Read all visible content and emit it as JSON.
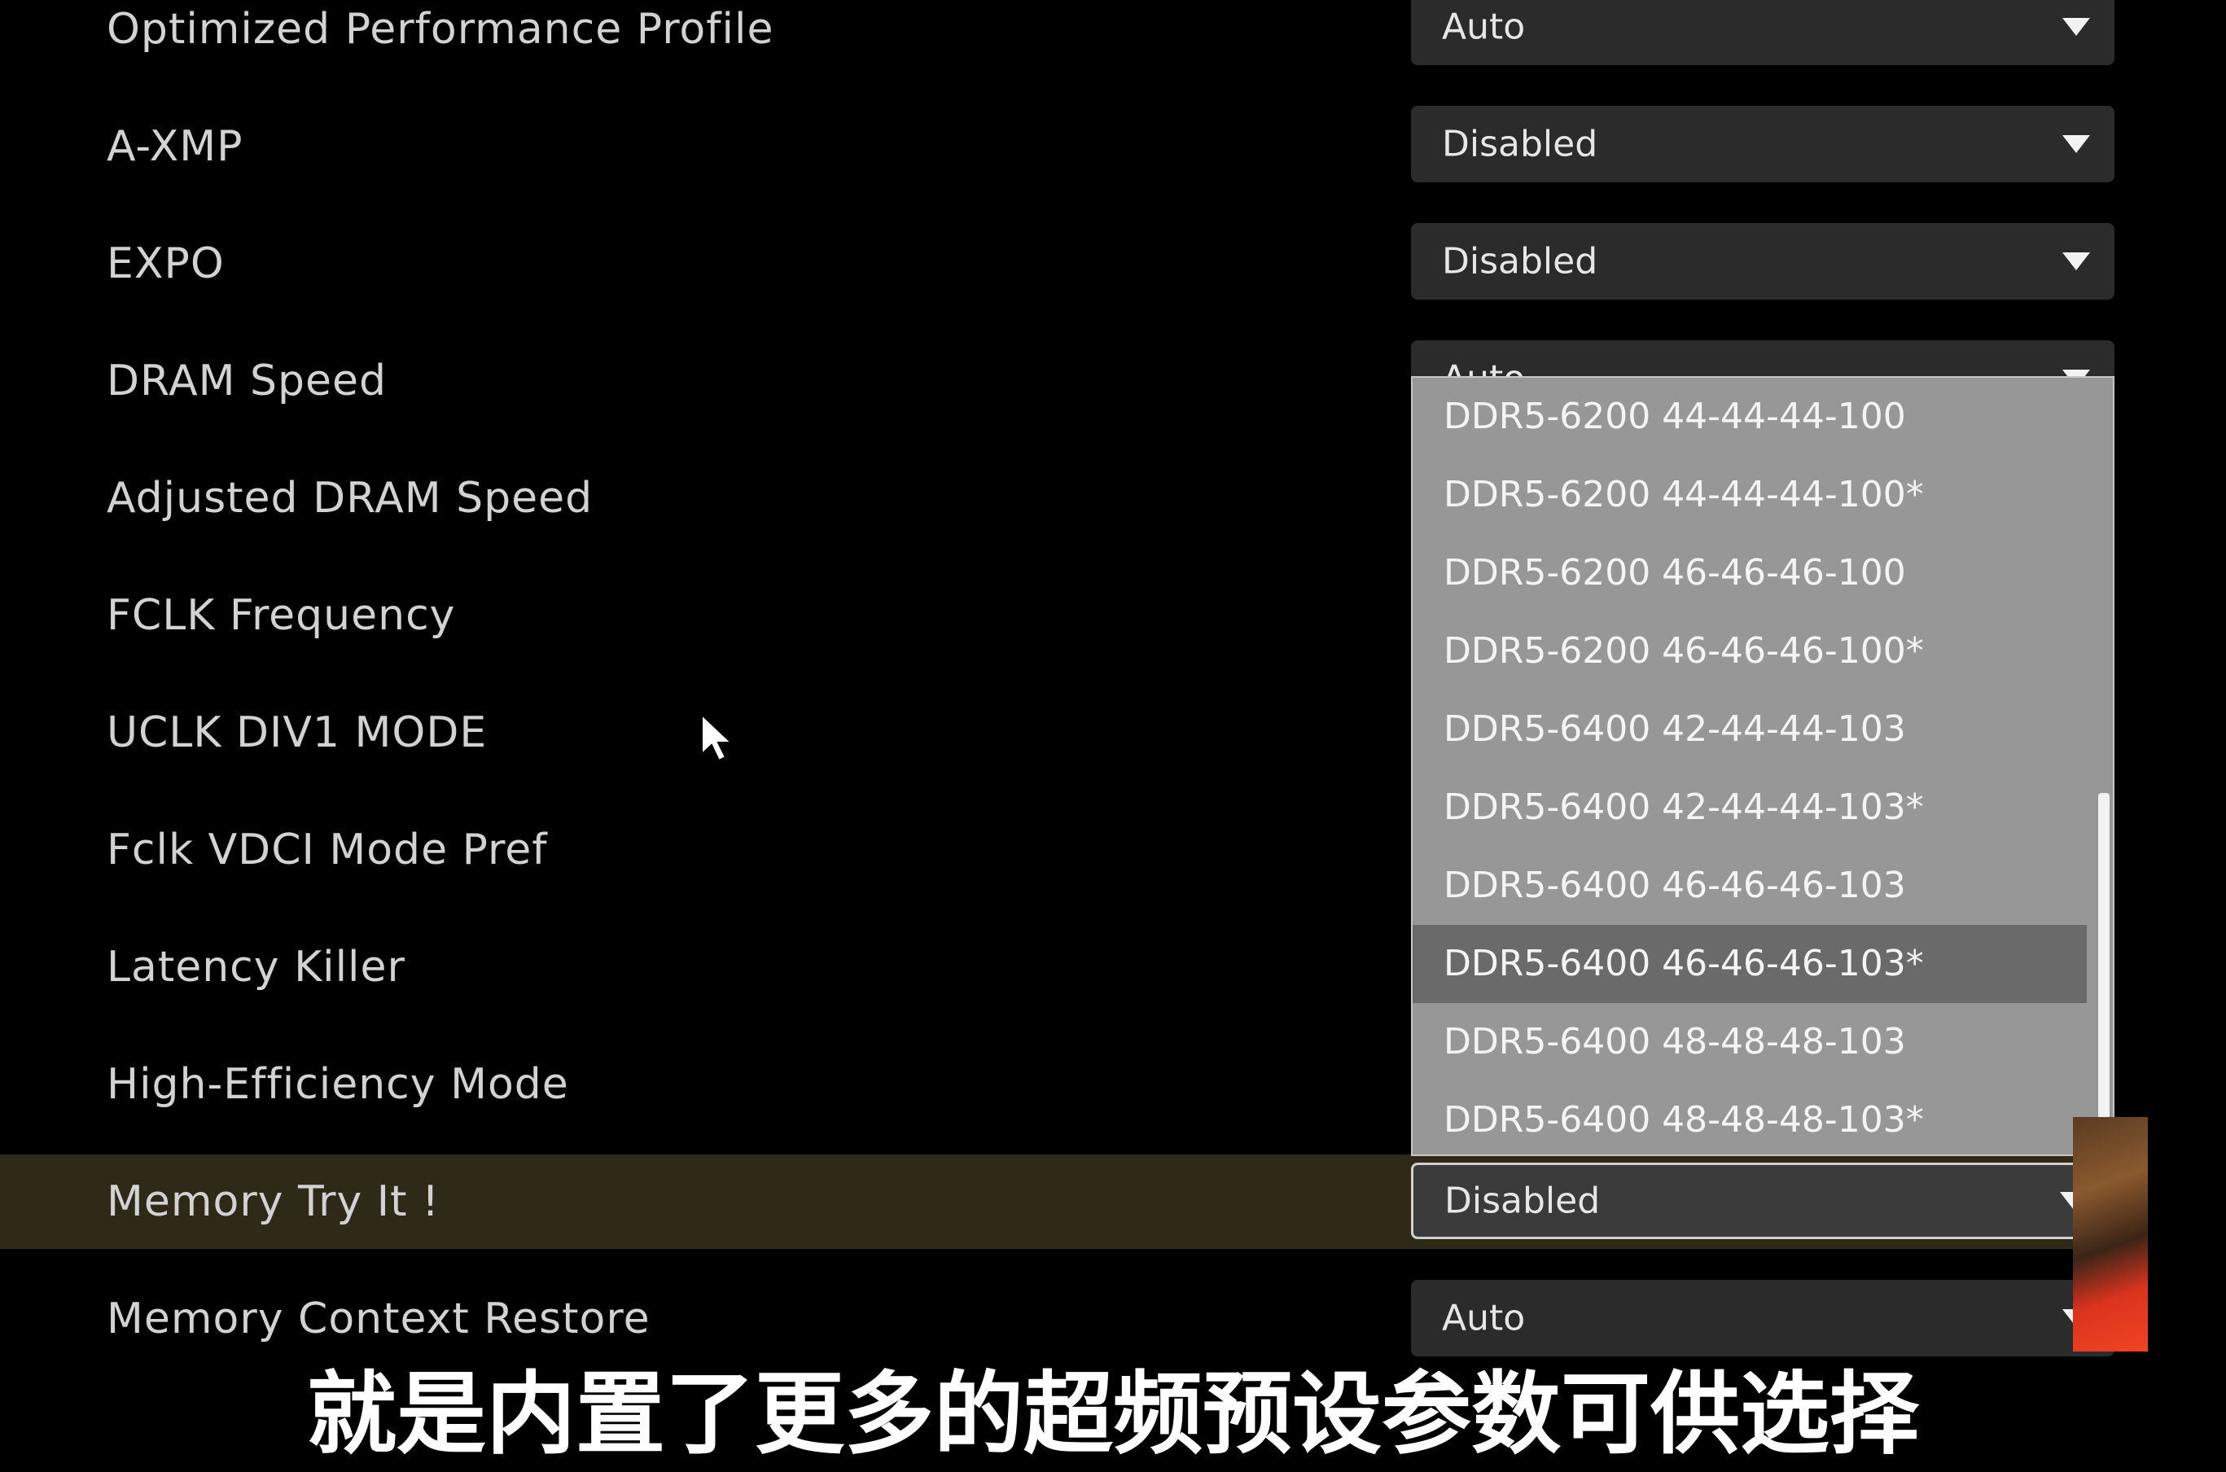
{
  "settings": [
    {
      "label": "Optimized Performance Profile",
      "value": "Auto"
    },
    {
      "label": "A-XMP",
      "value": "Disabled"
    },
    {
      "label": "EXPO",
      "value": "Disabled"
    },
    {
      "label": "DRAM Speed",
      "value": "Auto"
    },
    {
      "label": "Adjusted DRAM Speed"
    },
    {
      "label": "FCLK Frequency"
    },
    {
      "label": "UCLK DIV1 MODE"
    },
    {
      "label": "Fclk VDCI Mode Pref"
    },
    {
      "label": "Latency Killer"
    },
    {
      "label": "High-Efficiency Mode"
    },
    {
      "label": "Memory Try It !",
      "value": "Disabled"
    },
    {
      "label": "Memory Context Restore",
      "value": "Auto"
    }
  ],
  "dropdown": {
    "options": [
      "DDR5-6200 44-44-44-100",
      "DDR5-6200 44-44-44-100*",
      "DDR5-6200 46-46-46-100",
      "DDR5-6200 46-46-46-100*",
      "DDR5-6400 42-44-44-103",
      "DDR5-6400 42-44-44-103*",
      "DDR5-6400 46-46-46-103",
      "DDR5-6400 46-46-46-103*",
      "DDR5-6400 48-48-48-103",
      "DDR5-6400 48-48-48-103*"
    ],
    "highlighted_index": 7
  },
  "subtitle": "就是内置了更多的超频预设参数可供选择",
  "colors": {
    "background": "#000000",
    "highlight_band": "#2f2918",
    "select_bg": "#2b2b2b",
    "dropdown_bg": "#979797",
    "dropdown_selected": "#6a6a6a"
  },
  "icons": [
    "dropdown-arrow-icon",
    "mouse-pointer-icon"
  ]
}
